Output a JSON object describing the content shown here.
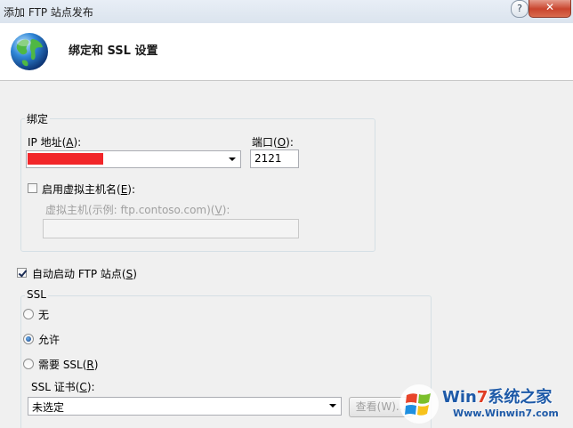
{
  "window": {
    "title": "添加 FTP 站点发布",
    "help": "?",
    "close": "✕"
  },
  "header": {
    "title": "绑定和 SSL 设置",
    "icon": "globe-icon"
  },
  "binding": {
    "group_label": "绑定",
    "ip_label_prefix": "IP 地址(",
    "ip_label_key": "A",
    "ip_label_suffix": "):",
    "port_label_prefix": "端口(",
    "port_label_key": "O",
    "port_label_suffix": "):",
    "port_value": "2121",
    "virtual_host_checkbox_prefix": "启用虚拟主机名(",
    "virtual_host_checkbox_key": "E",
    "virtual_host_checkbox_suffix": "):",
    "virtual_host_checked": false,
    "virtual_host_label_prefix": "虚拟主机(示例: ftp.contoso.com)(",
    "virtual_host_label_key": "V",
    "virtual_host_label_suffix": "):",
    "virtual_host_value": ""
  },
  "autostart": {
    "label_prefix": "自动启动 FTP 站点(",
    "label_key": "S",
    "label_suffix": ")",
    "checked": true
  },
  "ssl": {
    "group_label": "SSL",
    "options": [
      {
        "label": "无",
        "checked": false
      },
      {
        "label": "允许",
        "checked": true
      },
      {
        "label_prefix": "需要 SSL(",
        "label_key": "R",
        "label_suffix": ")",
        "checked": false
      }
    ],
    "cert_label_prefix": "SSL 证书(",
    "cert_label_key": "C",
    "cert_label_suffix": "):",
    "cert_value": "未选定",
    "view_button": "查看(W)..."
  },
  "watermark": {
    "brand_a": "Win",
    "brand_seven": "7",
    "brand_b": "系统之家",
    "url": "Www.Winwin7.com"
  },
  "colors": {
    "redaction": "#f2262a",
    "header_bg": "#ffffff",
    "dialog_bg": "#f0f0f0"
  }
}
